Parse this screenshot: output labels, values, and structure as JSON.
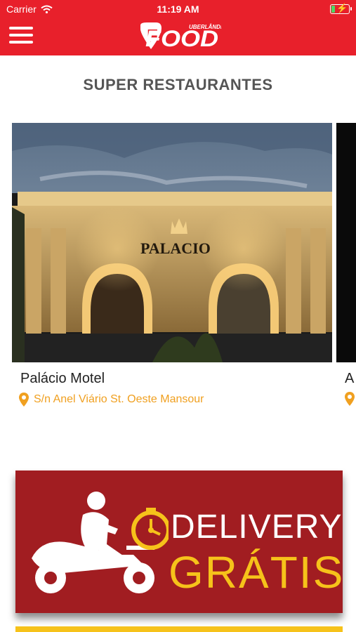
{
  "status_bar": {
    "carrier": "Carrier",
    "time": "11:19 AM",
    "battery_level": 0.2
  },
  "header": {
    "menu_icon": "hamburger-icon",
    "logo": {
      "small_text": "UBERLÂNDIA",
      "big_text": "FOOD"
    }
  },
  "section": {
    "title": "SUPER RESTAURANTES"
  },
  "restaurants": [
    {
      "name": "Palácio Motel",
      "address": "S/n Anel Viário St. Oeste Mansour",
      "image_sign": "PALACIO",
      "pin_icon": "location-pin-icon"
    },
    {
      "name": "A"
    }
  ],
  "banner": {
    "line1": "DELIVERY",
    "line2": "GRÁTIS",
    "icon": "delivery-scooter-icon"
  },
  "colors": {
    "brand_red": "#e8202b",
    "banner_red": "#a11d21",
    "accent_yellow": "#f6c21a",
    "address_orange": "#f0a020"
  }
}
